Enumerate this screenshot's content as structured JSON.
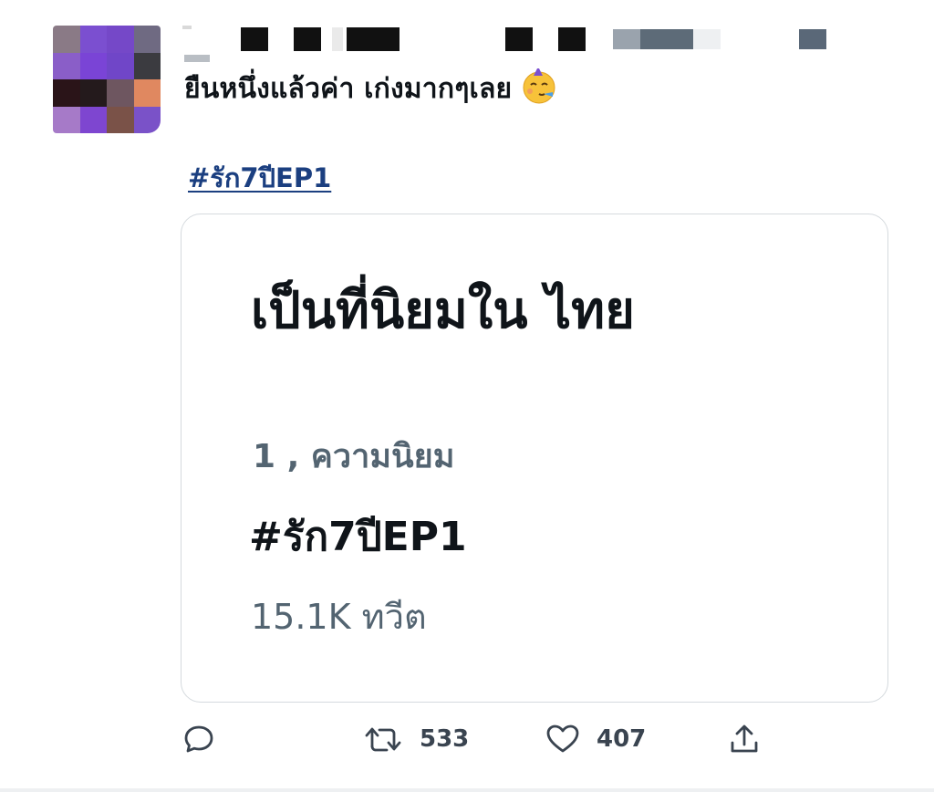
{
  "tweet": {
    "text": "ยืนหนึ่งแล้วค่า เก่งมากๆเลย",
    "emoji": "partying-face-emoji",
    "hashtag": "#รัก7ปีEP1"
  },
  "trend_card": {
    "title": "เป็นที่นิยมใน ไทย",
    "rank_label": "1 , ความนิยม",
    "trend_name": "#รัก7ปีEP1",
    "tweet_count": "15.1K ทวีต"
  },
  "actions": {
    "retweets": "533",
    "likes": "407"
  },
  "colors": {
    "link": "#1b3f80",
    "secondary_text": "#536471",
    "card_border": "#d5dade"
  }
}
